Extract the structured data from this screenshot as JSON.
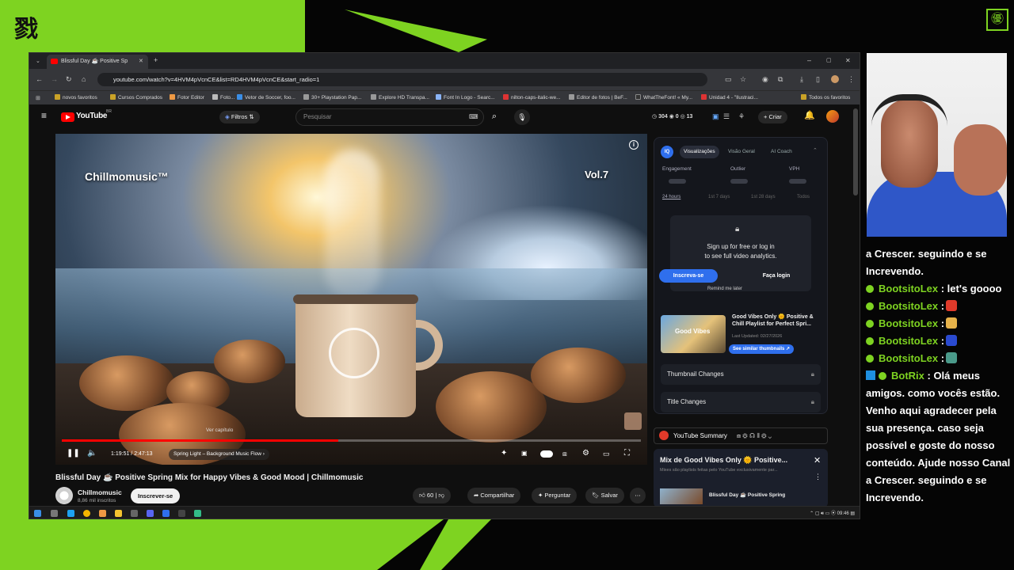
{
  "browser": {
    "tab_title": "Blissful Day ☕ Positive Sp",
    "url": "youtube.com/watch?v=4HVM4pVcnCE&list=RD4HVM4pVcnCE&start_radio=1",
    "bookmarks": [
      "novos favoritos",
      "Cursos Comprados",
      "Fotor Editor",
      "Foto...",
      "Vetor de Soccer, foo...",
      "30+ Playstation Pap...",
      "Explore HD Transpa...",
      "Font In Logo - Searc...",
      "nilton-caps-italic-we...",
      "Editor de fotos | BeF...",
      "WhatTheFont! « My...",
      "Unidad 4 - \"Ilustraci...",
      "Todos os favoritos"
    ]
  },
  "youtube": {
    "logo": "YouTube",
    "country": "BR",
    "filters_label": "Filtros",
    "search_placeholder": "Pesquisar",
    "stats": {
      "views": "304",
      "a": "0",
      "b": "13"
    },
    "create_label": "Criar"
  },
  "player": {
    "brand_overlay": "Chillmomusic™",
    "vol_overlay": "Vol.7",
    "chapter_tooltip": "Ver capítulo",
    "time": "1:19:51 / 2:47:13",
    "chapter": "Spring Light – Background Music Flow",
    "progress_fraction": 0.478
  },
  "video": {
    "title": "Blissful Day ☕ Positive Spring Mix for Happy Vibes & Good Mood | Chillmomusic",
    "channel": "Chillmomusic",
    "subscribers": "8,86 mil inscritos",
    "subscribe_label": "Inscrever-se",
    "likes": "60",
    "share_label": "Compartilhar",
    "ask_label": "Perguntar",
    "save_label": "Salvar"
  },
  "vidiq": {
    "logo": "IQ",
    "tabs": [
      "Visualizações",
      "Visão Geral",
      "AI Coach"
    ],
    "stats": [
      "Engagement",
      "Outlier",
      "VPH"
    ],
    "periods": [
      "24 hours",
      "1st 7 days",
      "1st 28 days",
      "Todos"
    ],
    "sign_line1": "Sign up for free or log in",
    "sign_line2": "to see full video analytics.",
    "signup_btn": "Inscreva-se",
    "login_btn": "Faça login",
    "remind": "Remind me later",
    "gv_title": "Good Vibes Only 🌞 Positive & Chill Playlist for Perfect Spri...",
    "gv_thumb": "Good Vibes",
    "gv_date": "Last Updated: 02/27/2026",
    "gv_btn": "See similar thumbnails ↗",
    "thumb_changes": "Thumbnail Changes",
    "title_changes": "Title Changes"
  },
  "summary": {
    "label": "YouTube Summary"
  },
  "mix": {
    "title": "Mix de Good Vibes Only 🌞 Positive...",
    "subtitle": "Mixes são playlists feitas pelo YouTube exclusivamente par...",
    "item": "Blissful Day ☕ Positive Spring"
  },
  "taskbar": {
    "time": "09:46"
  },
  "chat": [
    {
      "type": "text",
      "text": "a Crescer. seguindo e se Increvendo."
    },
    {
      "type": "msg",
      "user": "BootsitoLex",
      "text": ": let's goooo",
      "emote": ""
    },
    {
      "type": "msg",
      "user": "BootsitoLex",
      "text": ":",
      "emote": "#e03a2a"
    },
    {
      "type": "msg",
      "user": "BootsitoLex",
      "text": ":",
      "emote": "#e6b24a"
    },
    {
      "type": "msg",
      "user": "BootsitoLex",
      "text": ":",
      "emote": "#2a4ad0"
    },
    {
      "type": "msg",
      "user": "BootsitoLex",
      "text": ":",
      "emote": "#4a9a8a"
    },
    {
      "type": "msg",
      "user": "BotRix",
      "text": ": Olá meus amigos. como vocês estão. Venho aqui agradecer pela sua presença. caso seja possível e goste do nosso conteúdo. Ajude nosso Canal a Crescer. seguindo e se Increvendo.",
      "emote": ""
    }
  ],
  "colors": {
    "accent_green": "#7ed321",
    "yt_red": "#ff0000",
    "vidiq_blue": "#2f6fed"
  }
}
